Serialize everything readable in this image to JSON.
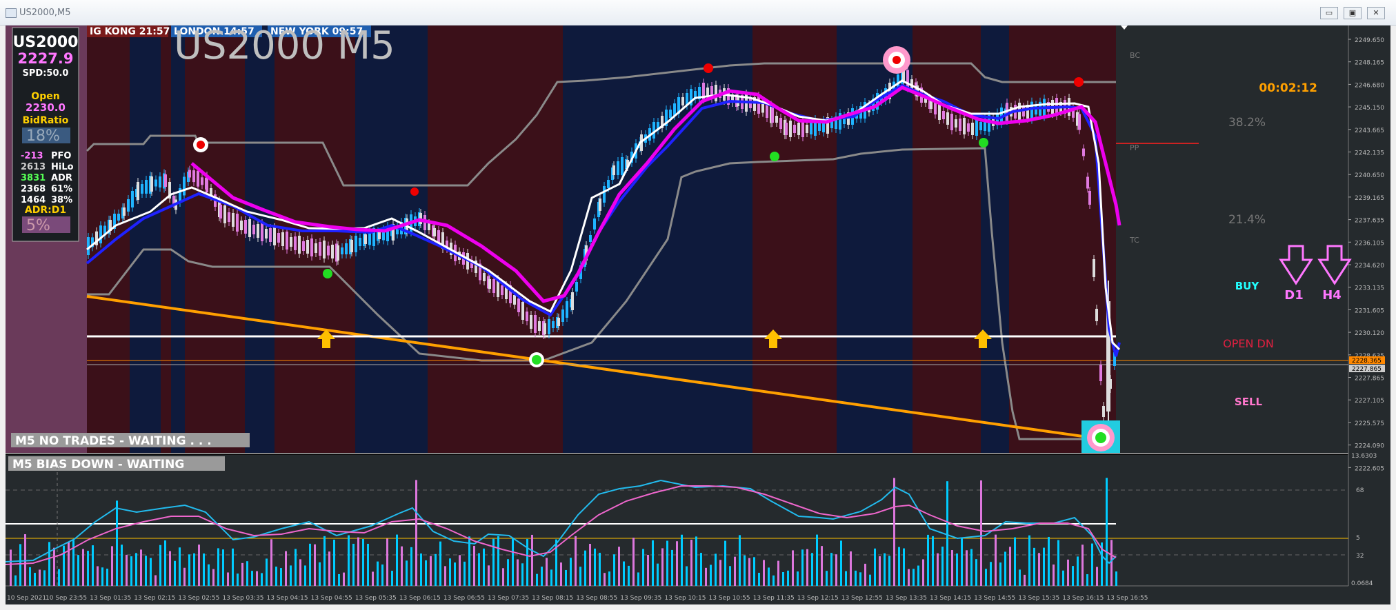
{
  "window": {
    "title": "US2000,M5",
    "min": "▭",
    "restore": "▣",
    "close": "✕"
  },
  "sessions": [
    {
      "label": "IG KONG 21:57",
      "color": "#7a1a1a"
    },
    {
      "label": "LONDON  14:57",
      "color": "#1f5fb0"
    },
    {
      "label": "NEW YORK  09:57",
      "color": "#1f5fb0"
    }
  ],
  "chart_title": "US2000 M5",
  "info_panel": {
    "symbol": "US2000",
    "price": "2227.9",
    "spread": "SPD:50.0",
    "open_label": "Open",
    "open_value": "2230.0",
    "bidratio_label": "BidRatio",
    "bidratio_value": "18%",
    "stats": [
      {
        "value": "-213",
        "label": "PFO",
        "color": "#ff77ff"
      },
      {
        "value": "2613",
        "label": "HiLo",
        "color": "#cccccc"
      },
      {
        "value": "3831",
        "label": "ADR",
        "color": "#55ff55"
      },
      {
        "value": "2368",
        "label": "61%",
        "color": "#ffffff"
      },
      {
        "value": "1464",
        "label": "38%",
        "color": "#ffffff"
      }
    ],
    "adr_label": "ADR:D1",
    "adr_value": "5%"
  },
  "right_panel": {
    "timer": "00:02:12",
    "fib1": "38.2%",
    "fib2": "21.4%",
    "buy": "BUY",
    "open_dn": "OPEN  DN",
    "sell": "SELL",
    "arrow1": "D1",
    "arrow2": "H4",
    "levels": [
      "BC",
      "PP",
      "TC"
    ]
  },
  "price_axis": [
    "2249.650",
    "2248.165",
    "2246.680",
    "2245.150",
    "2243.665",
    "2242.135",
    "2240.650",
    "2239.165",
    "2237.635",
    "2236.105",
    "2234.620",
    "2233.135",
    "2231.605",
    "2230.120",
    "2228.635",
    "2227.865",
    "2227.105",
    "2225.575",
    "2224.090",
    "2222.605"
  ],
  "price_tags": {
    "upper": "2228.365",
    "lower": "2227.865"
  },
  "status_main": "M5  NO TRADES - WAITING . . .",
  "status_sub": "M5  BIAS DOWN - WAITING",
  "osc_axis": {
    "top": "13.6303",
    "l68": "68",
    "l5": "5",
    "l32": "32",
    "bottom": "0.0684"
  },
  "time_axis": [
    "10 Sep 2021",
    "10 Sep 23:55",
    "13 Sep 01:35",
    "13 Sep 02:15",
    "13 Sep 02:55",
    "13 Sep 03:35",
    "13 Sep 04:15",
    "13 Sep 04:55",
    "13 Sep 05:35",
    "13 Sep 06:15",
    "13 Sep 06:55",
    "13 Sep 07:35",
    "13 Sep 08:15",
    "13 Sep 08:55",
    "13 Sep 09:35",
    "13 Sep 10:15",
    "13 Sep 10:55",
    "13 Sep 11:35",
    "13 Sep 12:15",
    "13 Sep 12:55",
    "13 Sep 13:35",
    "13 Sep 14:15",
    "13 Sep 14:55",
    "13 Sep 15:35",
    "13 Sep 16:15",
    "13 Sep 16:55"
  ],
  "colors": {
    "bear_bg": "#3b1019",
    "bull_bg": "#0e1a3c",
    "panel_bg": "#252a2d",
    "pink": "#ee00ee",
    "blue": "#1f22ff",
    "orange": "#ffa000",
    "cyan": "#00ccff",
    "magenta_bar": "#dd77dd"
  }
}
